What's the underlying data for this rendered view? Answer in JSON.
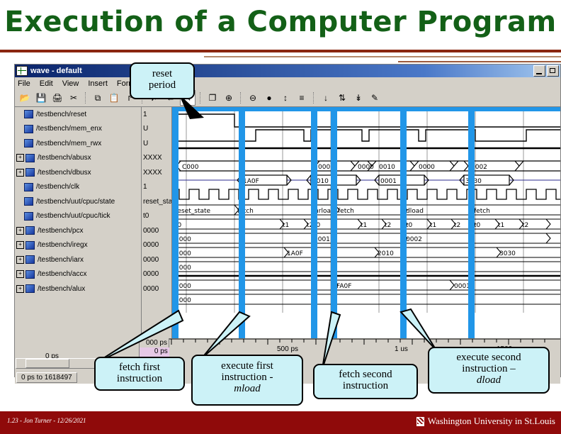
{
  "slide": {
    "title": "Execution of a Computer Program"
  },
  "window": {
    "title": "wave - default",
    "menu": [
      "File",
      "Edit",
      "View",
      "Insert",
      "Format"
    ],
    "min_label": "Minimize",
    "max_label": "Maximize",
    "toolbar": [
      {
        "name": "open-icon",
        "glyph": "📂"
      },
      {
        "name": "save-icon",
        "glyph": "💾"
      },
      {
        "name": "print-icon",
        "glyph": "🖨"
      },
      {
        "name": "cut-icon",
        "glyph": "✂"
      },
      {
        "name": "copy-icon",
        "glyph": "⧉"
      },
      {
        "name": "paste-icon",
        "glyph": "📋"
      },
      {
        "name": "insert-cursor-icon",
        "glyph": "↱"
      },
      {
        "name": "delete-cursor-icon",
        "glyph": "✗"
      },
      {
        "name": "previous-transition-icon",
        "glyph": "←"
      },
      {
        "name": "select-mode-icon",
        "glyph": "↖"
      },
      {
        "name": "group-icon",
        "glyph": "❐"
      },
      {
        "name": "zoom-in-icon",
        "glyph": "⊕"
      },
      {
        "name": "zoom-out-icon",
        "glyph": "⊖"
      },
      {
        "name": "zoom-fit-icon",
        "glyph": "●"
      },
      {
        "name": "zoom-range-icon",
        "glyph": "↕"
      },
      {
        "name": "wave-properties-icon",
        "glyph": "≡"
      },
      {
        "name": "insert-divider-icon",
        "glyph": "↓"
      },
      {
        "name": "sort-up-down-icon",
        "glyph": "⇅"
      },
      {
        "name": "sort-down-icon",
        "glyph": "↡"
      },
      {
        "name": "edit-signal-icon",
        "glyph": "✎"
      }
    ]
  },
  "signals": [
    {
      "name": "/testbench/reset",
      "value": "1",
      "expandable": false
    },
    {
      "name": "/testbench/mem_enx",
      "value": "U",
      "expandable": false
    },
    {
      "name": "/testbench/mem_rwx",
      "value": "U",
      "expandable": false
    },
    {
      "name": "/testbench/abusx",
      "value": "XXXX",
      "expandable": true
    },
    {
      "name": "/testbench/dbusx",
      "value": "XXXX",
      "expandable": true
    },
    {
      "name": "/testbench/clk",
      "value": "1",
      "expandable": false
    },
    {
      "name": "/testbench/uut/cpuc/state",
      "value": "reset_state",
      "expandable": false
    },
    {
      "name": "/testbench/uut/cpuc/tick",
      "value": "t0",
      "expandable": false
    },
    {
      "name": "/testbench/pcx",
      "value": "0000",
      "expandable": true
    },
    {
      "name": "/testbench/iregx",
      "value": "0000",
      "expandable": true
    },
    {
      "name": "/testbench/iarx",
      "value": "0000",
      "expandable": true
    },
    {
      "name": "/testbench/accx",
      "value": "0000",
      "expandable": true
    },
    {
      "name": "/testbench/alux",
      "value": "0000",
      "expandable": true
    }
  ],
  "wave_labels": {
    "abusx": [
      "C000",
      "0001",
      "0000",
      "0010",
      "0000",
      "0002"
    ],
    "dbusx": [
      "1A0F",
      "2010",
      "0001",
      "3030"
    ],
    "state": [
      "reset_state",
      "fetch",
      "mrload",
      "fetch",
      "dload",
      "fetch"
    ],
    "tick": [
      "t0",
      "t1",
      "t2",
      "t0",
      "t1",
      "t2",
      "t0",
      "t1",
      "t2",
      "t0",
      "t1",
      "t2"
    ],
    "pcx": [
      "0000",
      "0001",
      "0002"
    ],
    "iregx": [
      "0000",
      "1A0F",
      "2010",
      "3030"
    ],
    "iarx": [
      "0000"
    ],
    "accx": [
      "0000",
      "FA0F",
      "0001"
    ],
    "alux": [
      "0000"
    ]
  },
  "cursor": {
    "time_top": "000 ps",
    "time_bottom": "0 ps",
    "baseline_label": "0 ps"
  },
  "time_axis": {
    "labels": [
      "500 ps",
      "1 us",
      "1500 ns"
    ]
  },
  "status": {
    "range": "0 ps to 1618497"
  },
  "callouts": [
    {
      "id": "reset-period",
      "lines": [
        "reset",
        "period"
      ],
      "italic": ""
    },
    {
      "id": "fetch-first",
      "lines": [
        "fetch first",
        "instruction"
      ],
      "italic": ""
    },
    {
      "id": "execute-first",
      "lines": [
        "execute first",
        "instruction -"
      ],
      "italic": "mload"
    },
    {
      "id": "fetch-second",
      "lines": [
        "fetch second",
        "instruction"
      ],
      "italic": ""
    },
    {
      "id": "execute-second",
      "lines": [
        "execute second",
        "instruction –"
      ],
      "italic": "dload"
    }
  ],
  "footer": {
    "left": "1.23 - Jon Turner - 12/26/2021",
    "right": "Washington University in St.Louis"
  },
  "colors": {
    "title_green": "#136017",
    "rule_red": "#8a2610",
    "footer_red": "#8f0a0a",
    "highlight_blue": "#2196e8",
    "callout_fill": "#ccf2f7"
  }
}
